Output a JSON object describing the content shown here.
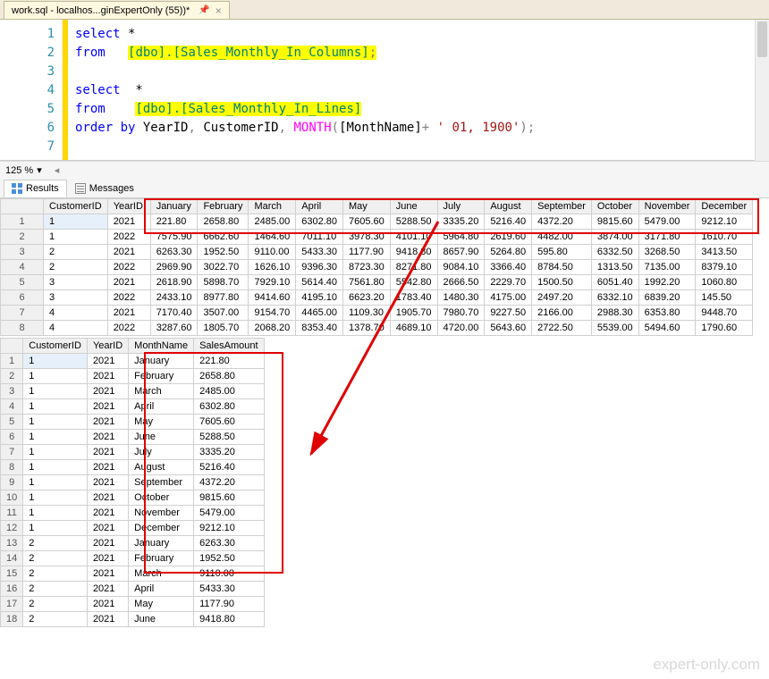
{
  "tab_title": "work.sql - localhos...ginExpertOnly (55))*",
  "zoom_level": "125 %",
  "editor": {
    "lines": [
      "1",
      "2",
      "3",
      "4",
      "5",
      "6",
      "7"
    ],
    "l1_kw": "select",
    "l1_star": " *",
    "l2_kw": "from",
    "l2_obj": "[dbo].[Sales_Monthly_In_Columns]",
    "l2_end": ";",
    "l4_kw": "select",
    "l4_star": "  *",
    "l5_kw": "from",
    "l5_obj": "[dbo].[Sales_Monthly_In_Lines]",
    "l6_kw": "order by",
    "l6_a": " YearID",
    "l6_b": " CustomerID",
    "l6_fn": "MONTH",
    "l6_c": "[MonthName]",
    "l6_plus": "+ ",
    "l6_str": "' 01, 1900'",
    "l6_end": ");"
  },
  "results_tab": "Results",
  "messages_tab": "Messages",
  "grid1": {
    "headers": [
      "CustomerID",
      "YearID",
      "January",
      "February",
      "March",
      "April",
      "May",
      "June",
      "July",
      "August",
      "September",
      "October",
      "November",
      "December"
    ],
    "rows": [
      [
        "1",
        "1",
        "2021",
        "221.80",
        "2658.80",
        "2485.00",
        "6302.80",
        "7605.60",
        "5288.50",
        "3335.20",
        "5216.40",
        "4372.20",
        "9815.60",
        "5479.00",
        "9212.10"
      ],
      [
        "2",
        "1",
        "2022",
        "7575.90",
        "6662.60",
        "1464.60",
        "7011.10",
        "3978.30",
        "4101.10",
        "5964.80",
        "2619.60",
        "4482.00",
        "3874.00",
        "3171.80",
        "1610.70"
      ],
      [
        "3",
        "2",
        "2021",
        "6263.30",
        "1952.50",
        "9110.00",
        "5433.30",
        "1177.90",
        "9418.80",
        "8657.90",
        "5264.80",
        "595.80",
        "6332.50",
        "3268.50",
        "3413.50"
      ],
      [
        "4",
        "2",
        "2022",
        "2969.90",
        "3022.70",
        "1626.10",
        "9396.30",
        "8723.30",
        "8271.80",
        "9084.10",
        "3366.40",
        "8784.50",
        "1313.50",
        "7135.00",
        "8379.10"
      ],
      [
        "5",
        "3",
        "2021",
        "2618.90",
        "5898.70",
        "7929.10",
        "5614.40",
        "7561.80",
        "5542.80",
        "2666.50",
        "2229.70",
        "1500.50",
        "6051.40",
        "1992.20",
        "1060.80"
      ],
      [
        "6",
        "3",
        "2022",
        "2433.10",
        "8977.80",
        "9414.60",
        "4195.10",
        "6623.20",
        "1783.40",
        "1480.30",
        "4175.00",
        "2497.20",
        "6332.10",
        "6839.20",
        "145.50"
      ],
      [
        "7",
        "4",
        "2021",
        "7170.40",
        "3507.00",
        "9154.70",
        "4465.00",
        "1109.30",
        "1905.70",
        "7980.70",
        "9227.50",
        "2166.00",
        "2988.30",
        "6353.80",
        "9448.70"
      ],
      [
        "8",
        "4",
        "2022",
        "3287.60",
        "1805.70",
        "2068.20",
        "8353.40",
        "1378.70",
        "4689.10",
        "4720.00",
        "5643.60",
        "2722.50",
        "5539.00",
        "5494.60",
        "1790.60"
      ]
    ]
  },
  "grid2": {
    "headers": [
      "CustomerID",
      "YearID",
      "MonthName",
      "SalesAmount"
    ],
    "rows": [
      [
        "1",
        "1",
        "2021",
        "January",
        "221.80"
      ],
      [
        "2",
        "1",
        "2021",
        "February",
        "2658.80"
      ],
      [
        "3",
        "1",
        "2021",
        "March",
        "2485.00"
      ],
      [
        "4",
        "1",
        "2021",
        "April",
        "6302.80"
      ],
      [
        "5",
        "1",
        "2021",
        "May",
        "7605.60"
      ],
      [
        "6",
        "1",
        "2021",
        "June",
        "5288.50"
      ],
      [
        "7",
        "1",
        "2021",
        "July",
        "3335.20"
      ],
      [
        "8",
        "1",
        "2021",
        "August",
        "5216.40"
      ],
      [
        "9",
        "1",
        "2021",
        "September",
        "4372.20"
      ],
      [
        "10",
        "1",
        "2021",
        "October",
        "9815.60"
      ],
      [
        "11",
        "1",
        "2021",
        "November",
        "5479.00"
      ],
      [
        "12",
        "1",
        "2021",
        "December",
        "9212.10"
      ],
      [
        "13",
        "2",
        "2021",
        "January",
        "6263.30"
      ],
      [
        "14",
        "2",
        "2021",
        "February",
        "1952.50"
      ],
      [
        "15",
        "2",
        "2021",
        "March",
        "9110.00"
      ],
      [
        "16",
        "2",
        "2021",
        "April",
        "5433.30"
      ],
      [
        "17",
        "2",
        "2021",
        "May",
        "1177.90"
      ],
      [
        "18",
        "2",
        "2021",
        "June",
        "9418.80"
      ]
    ]
  },
  "watermark": "expert-only.com"
}
